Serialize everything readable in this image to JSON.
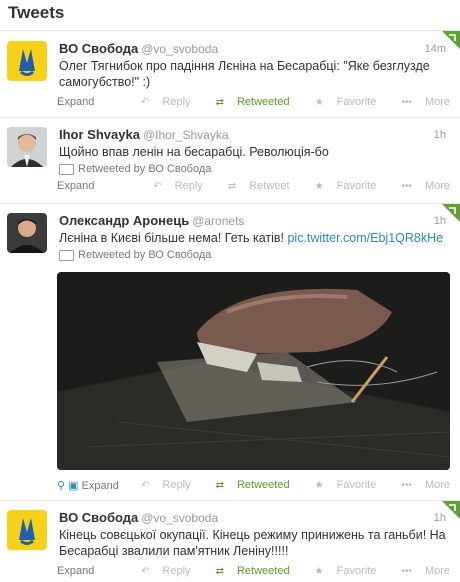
{
  "header": {
    "title": "Tweets"
  },
  "tweets": [
    {
      "name": "ВО Свобода",
      "handle": "@vo_svoboda",
      "time": "14m",
      "text": "Олег Тягнибок про падіння Лєніна на Бесарабці: \"Яке безглузде самогубство!\" :)",
      "expand": "Expand",
      "reply": "Reply",
      "retweet": "Retweeted",
      "favorite": "Favorite",
      "more": "More"
    },
    {
      "name": "Ihor Shvayka",
      "handle": "@Ihor_Shvayka",
      "time": "1h",
      "text": "Щойно впав ленін на бесарабці. Революція-бо",
      "retweeted_by": "Retweeted by ВО Свобода",
      "expand": "Expand",
      "reply": "Reply",
      "retweet": "Retweet",
      "favorite": "Favorite",
      "more": "More"
    },
    {
      "name": "Олександр Аронець",
      "handle": "@aronets",
      "time": "1h",
      "text": "Лєніна в Києві більше нема! Геть катів!",
      "link": "pic.twitter.com/Ebj1QR8kHe",
      "retweeted_by": "Retweeted by ВО Свобода",
      "expand": "Expand",
      "reply": "Reply",
      "retweet": "Retweeted",
      "favorite": "Favorite",
      "more": "More"
    },
    {
      "name": "ВО Свобода",
      "handle": "@vo_svoboda",
      "time": "1h",
      "text": "Кінець совєцької окупації. Кінець режиму принижень та ганьби! На Бесарабці звалили пам'ятник Леніну!!!!!",
      "expand": "Expand",
      "reply": "Reply",
      "retweet": "Retweeted",
      "favorite": "Favorite",
      "more": "More"
    }
  ],
  "colors": {
    "accent_green": "#609928",
    "link_blue": "#2a8bb8",
    "svoboda_yellow": "#f7d117",
    "svoboda_blue": "#1f5fae"
  }
}
